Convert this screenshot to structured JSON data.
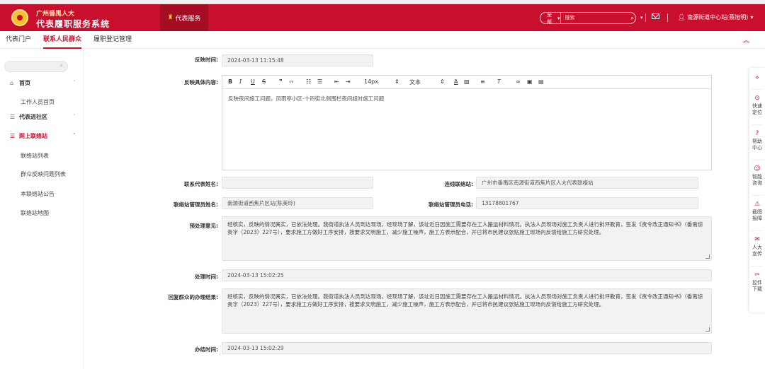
{
  "header": {
    "brand_top": "广州番禺人大",
    "brand_main": "代表履职服务系统",
    "nav_active": "代表服务",
    "search_scope": "全部",
    "search_placeholder": "搜索",
    "user_name": "南源街道中心站(蔡旭明)"
  },
  "tabs": [
    "代表门户",
    "联系人民群众",
    "履职登记管理"
  ],
  "sidebar": {
    "menu": [
      {
        "label": "首页",
        "icon": "home-icon",
        "sub": [
          "工作人员首页"
        ]
      },
      {
        "label": "代表进社区",
        "icon": "list-icon",
        "sub": []
      },
      {
        "label": "网上联络站",
        "icon": "list-icon",
        "sub": [
          "联络站列表",
          "群众反映问题列表",
          "本联络站公告",
          "联络站地图"
        ]
      }
    ]
  },
  "form": {
    "fanying_time_label": "反映时间:",
    "fanying_time": "2024-03-13 11:15:48",
    "content_label": "反映具体内容:",
    "editor_toolbar": {
      "font_size": "14px",
      "text_style": "文本"
    },
    "content": "反映夜间施工问题，凤雨亭小区-十四街北侧围栏夜间超时施工问题",
    "rep_name_label": "联系代表姓名:",
    "rep_name": "",
    "station_label": "连线联络站:",
    "station": "广州市番禺区南源街道西焦片区人大代表联络站",
    "manager_label": "联络站管理员姓名:",
    "manager": "南源街道西焦片区站(陈美玲)",
    "phone_label": "联络站管理员电话:",
    "phone": "13178801767",
    "pre_opinion_label": "预处理意见:",
    "pre_opinion": "经核实，反映的情况属实，已依法处理。我街道执法人员到达现场，经现场了解，该址近日因施工需要存在工人搬运材料情况。执法人员现场对施工负责人进行批评教育，签发《责令改正通知书》（番南综责字（2023）227号），要求施工方做好工序安排，按要求文明施工，减少施工噪声，施工方表示配合，并已将市民建议张贴施工现场向反馈给施工方研究处理。",
    "handle_time_label": "处理时间:",
    "handle_time": "2024-03-13 15:02:25",
    "reply_label": "回复群众的办理结果:",
    "reply": "经核实，反映的情况属实，已依法处理。我街道执法人员到达现场，经现场了解，该址近日因施工需要存在工人搬运材料情况。执法人员现场对施工负责人进行批评教育，签发《责令改正通知书》（番南综责字（2023）227号），要求施工方做好工序安排，按要求文明施工，减少施工噪声，施工方表示配合，并已将市民建议张贴施工现场向反馈给施工方研究处理。",
    "finish_time_label": "办结时间:",
    "finish_time": "2024-03-13 15:02:29"
  },
  "floatbar": [
    {
      "label": "快速定位",
      "icon": "location-icon"
    },
    {
      "label": "帮助中心",
      "icon": "help-icon"
    },
    {
      "label": "智能咨询",
      "icon": "chat-icon"
    },
    {
      "label": "截图报障",
      "icon": "warning-icon"
    },
    {
      "label": "人大宣传",
      "icon": "mail-icon"
    },
    {
      "label": "控件下载",
      "icon": "tools-icon"
    }
  ],
  "colors": {
    "primary": "#c8102e",
    "header_dark": "#a50d24",
    "field_bg": "#f2f2f2"
  }
}
